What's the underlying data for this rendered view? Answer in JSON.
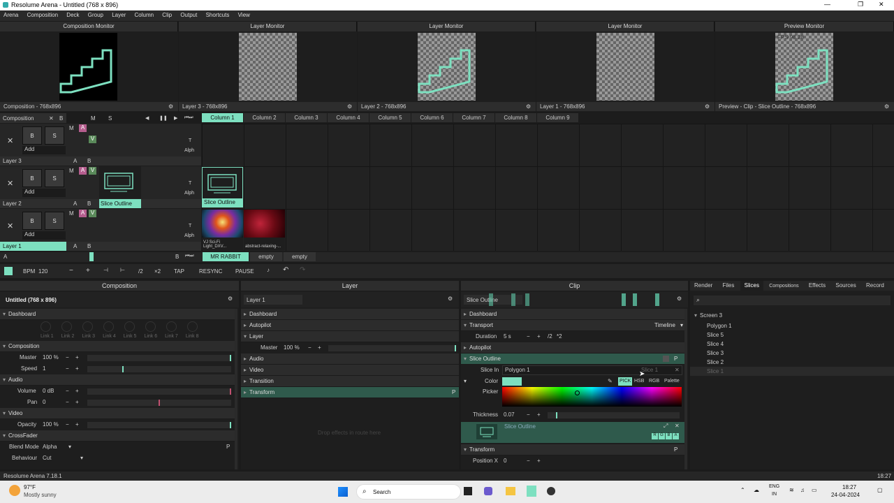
{
  "window": {
    "title": "Resolume Arena - Untitled (768 x 896)",
    "min": "—",
    "max": "❐",
    "close": "✕"
  },
  "menu": [
    "Arena",
    "Composition",
    "Deck",
    "Group",
    "Layer",
    "Column",
    "Clip",
    "Output",
    "Shortcuts",
    "View"
  ],
  "monitors": [
    {
      "title": "Composition Monitor",
      "footer": "Composition - 768x896"
    },
    {
      "title": "Layer Monitor",
      "footer": "Layer 3 - 768x896"
    },
    {
      "title": "Layer Monitor",
      "footer": "Layer 2 - 768x896"
    },
    {
      "title": "Layer Monitor",
      "footer": "Layer 1 - 768x896"
    },
    {
      "title": "Preview Monitor",
      "footer": "Preview - Clip - Slice Outline - 768x896",
      "fps": "FPS 98.28"
    }
  ],
  "deck": {
    "composition_label": "Composition",
    "x": "✕",
    "b": "B",
    "m": "M",
    "s": "S",
    "columns": [
      "Column 1",
      "Column 2",
      "Column 3",
      "Column 4",
      "Column 5",
      "Column 6",
      "Column 7",
      "Column 8",
      "Column 9"
    ],
    "layers": [
      {
        "name": "Layer 3",
        "add": "Add",
        "a": "A",
        "b": "B",
        "clips": []
      },
      {
        "name": "Layer 2",
        "add": "Add",
        "a": "A",
        "b": "B",
        "clip_label": "Slice Outline",
        "preview_label": "Slice Outline"
      },
      {
        "name": "Layer 1",
        "add": "Add",
        "a": "A",
        "b": "B",
        "clip1": "VJ Sci-Fi Light_DXV...",
        "clip2": "abstract-relaxing-..."
      }
    ],
    "t": "T",
    "alph": "Alph",
    "bottom_a": "A",
    "bottom_b": "B",
    "decks": [
      "MR RABBIT",
      "empty",
      "empty"
    ]
  },
  "transport": {
    "bpm_label": "BPM",
    "bpm": "120",
    "minus": "−",
    "plus": "+",
    "half": "/2",
    "double": "×2",
    "tap": "TAP",
    "resync": "RESYNC",
    "pause": "PAUSE"
  },
  "composition_panel": {
    "title": "Composition",
    "name": "Untitled (768 x 896)",
    "dashboard": "Dashboard",
    "links": [
      "Link 1",
      "Link 2",
      "Link 3",
      "Link 4",
      "Link 5",
      "Link 6",
      "Link 7",
      "Link 8"
    ],
    "composition": "Composition",
    "master_label": "Master",
    "master": "100 %",
    "speed_label": "Speed",
    "speed": "1",
    "audio": "Audio",
    "volume_label": "Volume",
    "volume": "0 dB",
    "pan_label": "Pan",
    "pan": "0",
    "video": "Video",
    "opacity_label": "Opacity",
    "opacity": "100 %",
    "crossfader": "CrossFader",
    "blend_label": "Blend Mode",
    "blend": "Alpha",
    "behaviour_label": "Behaviour",
    "behaviour": "Cut",
    "p": "P"
  },
  "layer_panel": {
    "title": "Layer",
    "name": "Layer 1",
    "dashboard": "Dashboard",
    "autopilot": "Autopilot",
    "layer": "Layer",
    "master_label": "Master",
    "master": "100 %",
    "audio": "Audio",
    "video": "Video",
    "transition": "Transition",
    "transform": "Transform",
    "drop_hint": "Drop effects in route here",
    "p": "P"
  },
  "clip_panel": {
    "title": "Clip",
    "name": "Slice Outline",
    "dashboard": "Dashboard",
    "transport": "Transport",
    "timeline": "Timeline",
    "duration_label": "Duration",
    "duration": "5 s",
    "half": "/2",
    "double": "*2",
    "autopilot": "Autopilot",
    "slice_outline": "Slice Outline",
    "slice_in_label": "Slice In",
    "slice_in": "Polygon 1",
    "slice_hint": "Slice 1",
    "color_label": "Color",
    "pick": "PICK",
    "hsb": "HSB",
    "rgb": "RGB",
    "palette": "Palette",
    "picker_label": "Picker",
    "thickness_label": "Thickness",
    "thickness": "0.07",
    "effect_title": "Slice Outline",
    "rgba": [
      "R",
      "G",
      "B",
      "A"
    ],
    "transform": "Transform",
    "position_x_label": "Position X",
    "position_x": "0",
    "p": "P"
  },
  "right_panel": {
    "tabs": [
      "Render",
      "Files",
      "Slices",
      "Compositions",
      "Effects",
      "Sources",
      "Record"
    ],
    "active": "Slices",
    "tree": [
      "Screen 3",
      "Polygon 1",
      "Slice 5",
      "Slice 4",
      "Slice 3",
      "Slice 2",
      "Slice 1"
    ]
  },
  "status": {
    "version": "Resolume Arena 7.18.1",
    "time": "18:27"
  },
  "taskbar": {
    "temp": "97°F",
    "weather": "Mostly sunny",
    "search": "Search",
    "lang1": "ENG",
    "lang2": "IN",
    "clock": "18:27",
    "date": "24-04-2024"
  },
  "colors": {
    "accent": "#7de0c0",
    "bg": "#1b1b1b"
  }
}
